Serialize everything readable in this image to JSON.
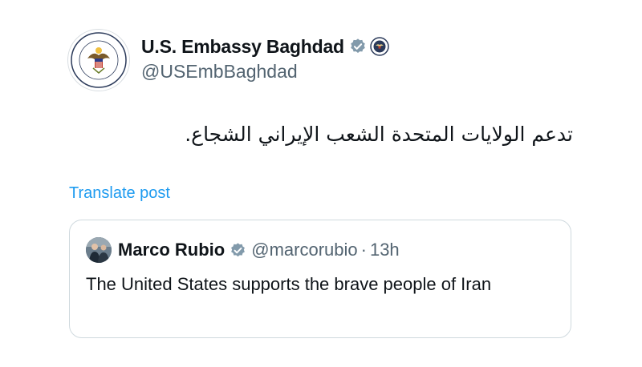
{
  "post": {
    "author_name": "U.S. Embassy Baghdad",
    "author_handle": "@USEmbBaghdad",
    "avatar_seal_text_top": "UNITED STATES EMBASSY",
    "avatar_seal_text_bottom": "BAGHDAD",
    "verified_icon": "verified-badge-icon",
    "gov_icon": "government-seal-icon",
    "text": "تدعم الولايات المتحدة الشعب الإيراني الشجاع.",
    "translate_label": "Translate post"
  },
  "quote": {
    "author_name": "Marco Rubio",
    "author_handle": "@marcorubio",
    "separator": "·",
    "time": "13h",
    "text": "The United States supports the brave people of Iran"
  },
  "colors": {
    "link": "#1d9bf0",
    "verified_gray": "#829aab",
    "secondary_text": "#536471",
    "border": "#cfd9de"
  }
}
